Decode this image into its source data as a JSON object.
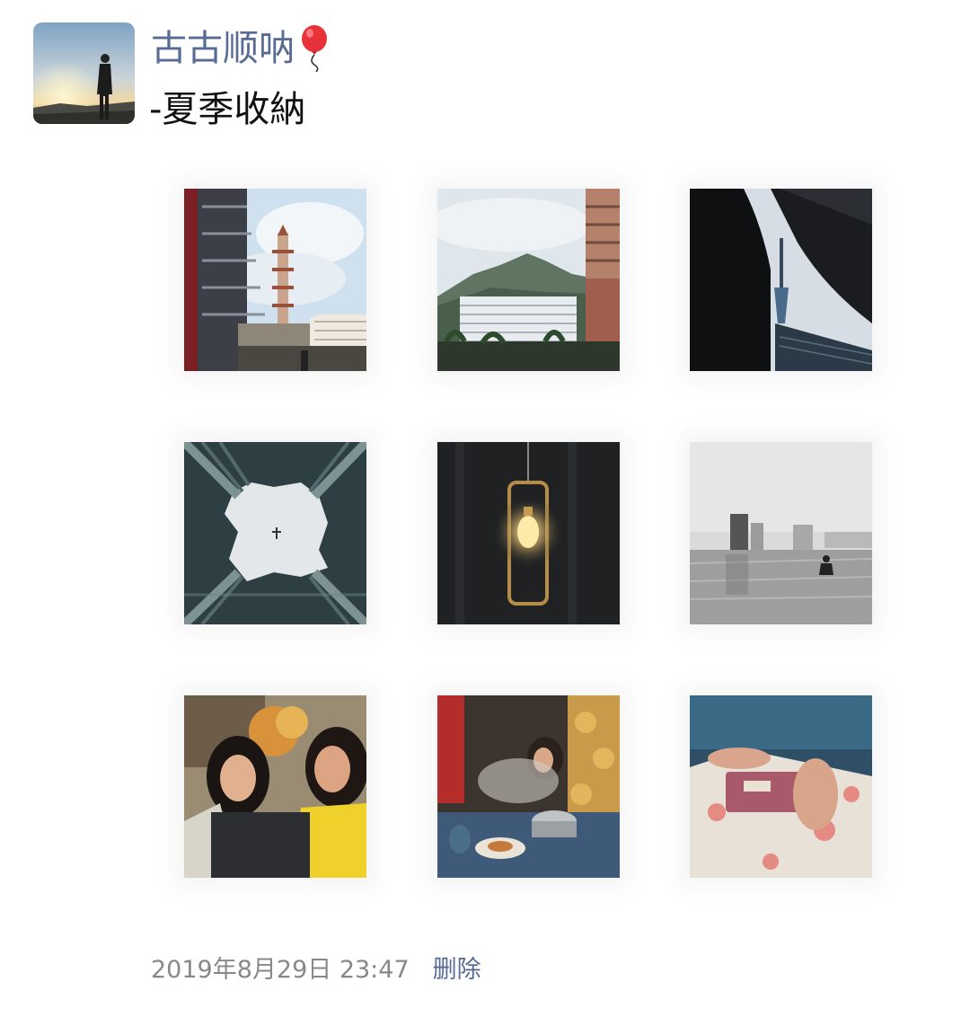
{
  "post": {
    "author_name": "古古顺呐",
    "author_emoji": "balloon-icon",
    "caption": "-夏季收納",
    "timestamp": "2019年8月29日 23:47",
    "delete_label": "删除"
  },
  "colors": {
    "link": "#576b95",
    "timestamp": "#888888",
    "text": "#111111"
  },
  "photos": [
    {
      "subject": "city-street-pagoda-photo"
    },
    {
      "subject": "mountain-buildings-photo"
    },
    {
      "subject": "tv-tower-photo"
    },
    {
      "subject": "skyscrapers-upward-photo"
    },
    {
      "subject": "hanging-lightbulb-photo"
    },
    {
      "subject": "rainy-square-photo"
    },
    {
      "subject": "friends-covering-faces-photo"
    },
    {
      "subject": "hotpot-dinner-photo"
    },
    {
      "subject": "pink-pouch-photo"
    }
  ]
}
